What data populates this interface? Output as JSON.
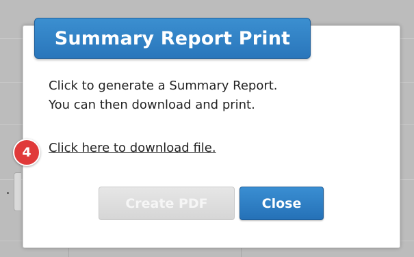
{
  "dialog": {
    "title": "Summary Report Print",
    "description_line1": "Click to generate a Summary Report.",
    "description_line2": "You can then download and print.",
    "step_badge": "4",
    "download_link": "Click here to download file.",
    "create_pdf_label": "Create PDF",
    "close_label": "Close"
  },
  "colors": {
    "title_bg": "#2a76bb",
    "badge_bg": "#e03a3a",
    "close_bg": "#2571b7",
    "create_pdf_disabled_bg": "#d6d6d6"
  }
}
